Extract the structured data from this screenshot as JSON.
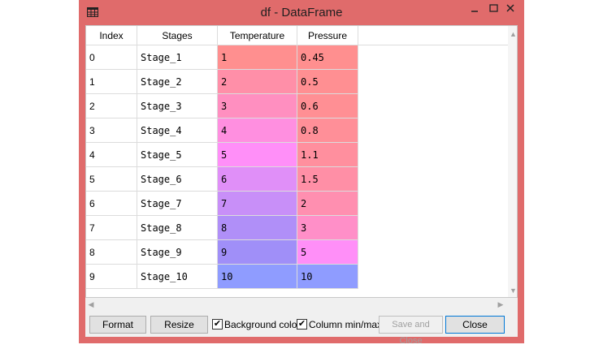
{
  "window": {
    "title": "df - DataFrame"
  },
  "table": {
    "headers": [
      "Index",
      "Stages",
      "Temperature",
      "Pressure"
    ],
    "rows": [
      {
        "index": "0",
        "stage": "Stage_1",
        "temperature": "1",
        "pressure": "0.45",
        "temp_color": "#ff8f8f",
        "press_color": "#ff8f8f"
      },
      {
        "index": "1",
        "stage": "Stage_2",
        "temperature": "2",
        "pressure": "0.5",
        "temp_color": "#ff8fa8",
        "press_color": "#ff8f92"
      },
      {
        "index": "2",
        "stage": "Stage_3",
        "temperature": "3",
        "pressure": "0.6",
        "temp_color": "#ff8fc0",
        "press_color": "#ff8f94"
      },
      {
        "index": "3",
        "stage": "Stage_4",
        "temperature": "4",
        "pressure": "0.8",
        "temp_color": "#ff8fe0",
        "press_color": "#ff8f98"
      },
      {
        "index": "4",
        "stage": "Stage_5",
        "temperature": "5",
        "pressure": "1.1",
        "temp_color": "#ff8ff8",
        "press_color": "#ff8f9e"
      },
      {
        "index": "5",
        "stage": "Stage_6",
        "temperature": "6",
        "pressure": "1.5",
        "temp_color": "#e08ff8",
        "press_color": "#ff8fa6"
      },
      {
        "index": "6",
        "stage": "Stage_7",
        "temperature": "7",
        "pressure": "2",
        "temp_color": "#c88ff8",
        "press_color": "#ff8fb0"
      },
      {
        "index": "7",
        "stage": "Stage_8",
        "temperature": "8",
        "pressure": "3",
        "temp_color": "#b08ff8",
        "press_color": "#ff8fc8"
      },
      {
        "index": "8",
        "stage": "Stage_9",
        "temperature": "9",
        "pressure": "5",
        "temp_color": "#a08ff8",
        "press_color": "#ff8ff8"
      },
      {
        "index": "9",
        "stage": "Stage_10",
        "temperature": "10",
        "pressure": "10",
        "temp_color": "#8f9cff",
        "press_color": "#8f9cff"
      }
    ]
  },
  "buttons": {
    "format": "Format",
    "resize": "Resize",
    "save_close": "Save and Close",
    "close": "Close"
  },
  "checkboxes": {
    "background_color": {
      "label": "Background color",
      "checked": true
    },
    "column_minmax": {
      "label": "Column min/max",
      "checked": true
    }
  }
}
